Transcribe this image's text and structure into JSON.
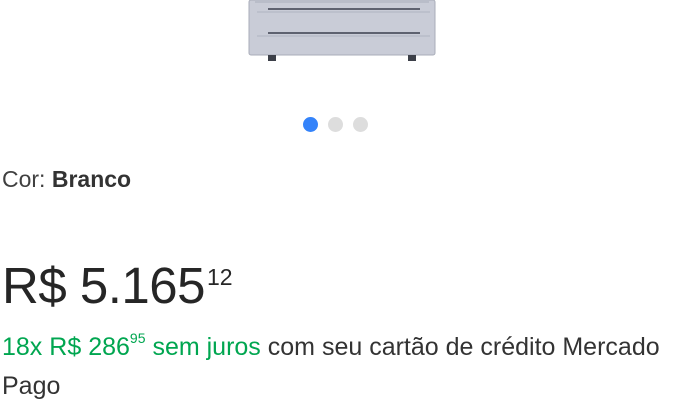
{
  "product": {
    "color_label": "Cor:",
    "color_value": "Branco"
  },
  "carousel": {
    "total": 3,
    "active": 1
  },
  "price": {
    "currency": "R$",
    "integer": "5.165",
    "cents": "12"
  },
  "installments": {
    "count": "18x",
    "currency": "R$",
    "integer": "286",
    "cents": "95",
    "interest_free": "sem juros",
    "suffix": "com seu cartão de crédito Mercado Pago"
  },
  "colors": {
    "accent_blue": "#3483fa",
    "success_green": "#00a650",
    "dot_inactive": "#dddddd"
  }
}
